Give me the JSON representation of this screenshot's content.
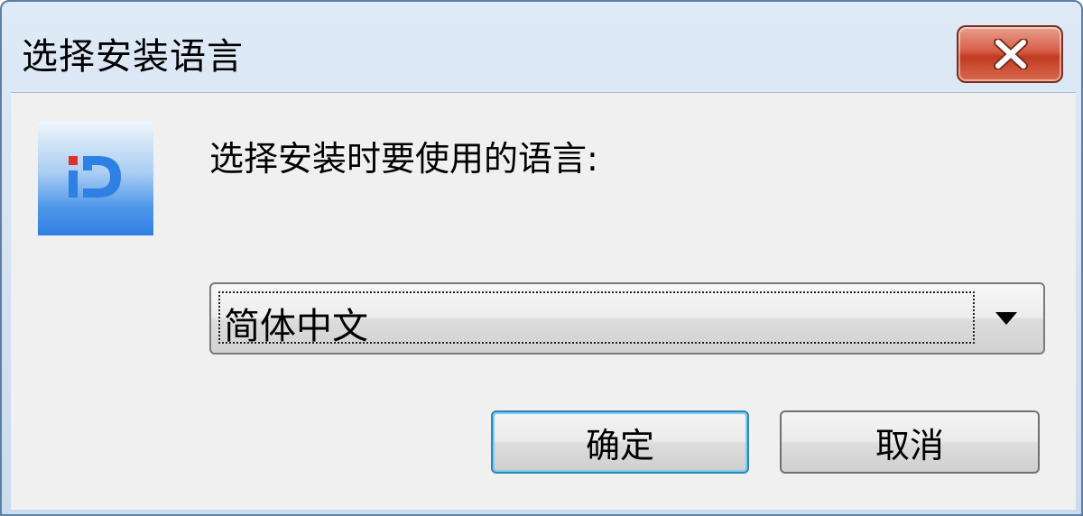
{
  "window": {
    "title": "选择安装语言",
    "close_icon": "close-icon"
  },
  "content": {
    "prompt": "选择安装时要使用的语言:",
    "logo_icon": "app-logo-icon"
  },
  "language_select": {
    "selected": "简体中文",
    "arrow_icon": "dropdown-arrow-icon"
  },
  "buttons": {
    "ok": "确定",
    "cancel": "取消"
  },
  "colors": {
    "logo_blue": "#2f80e4",
    "logo_red": "#e0302a",
    "focus_border": "#3c7fb1"
  }
}
